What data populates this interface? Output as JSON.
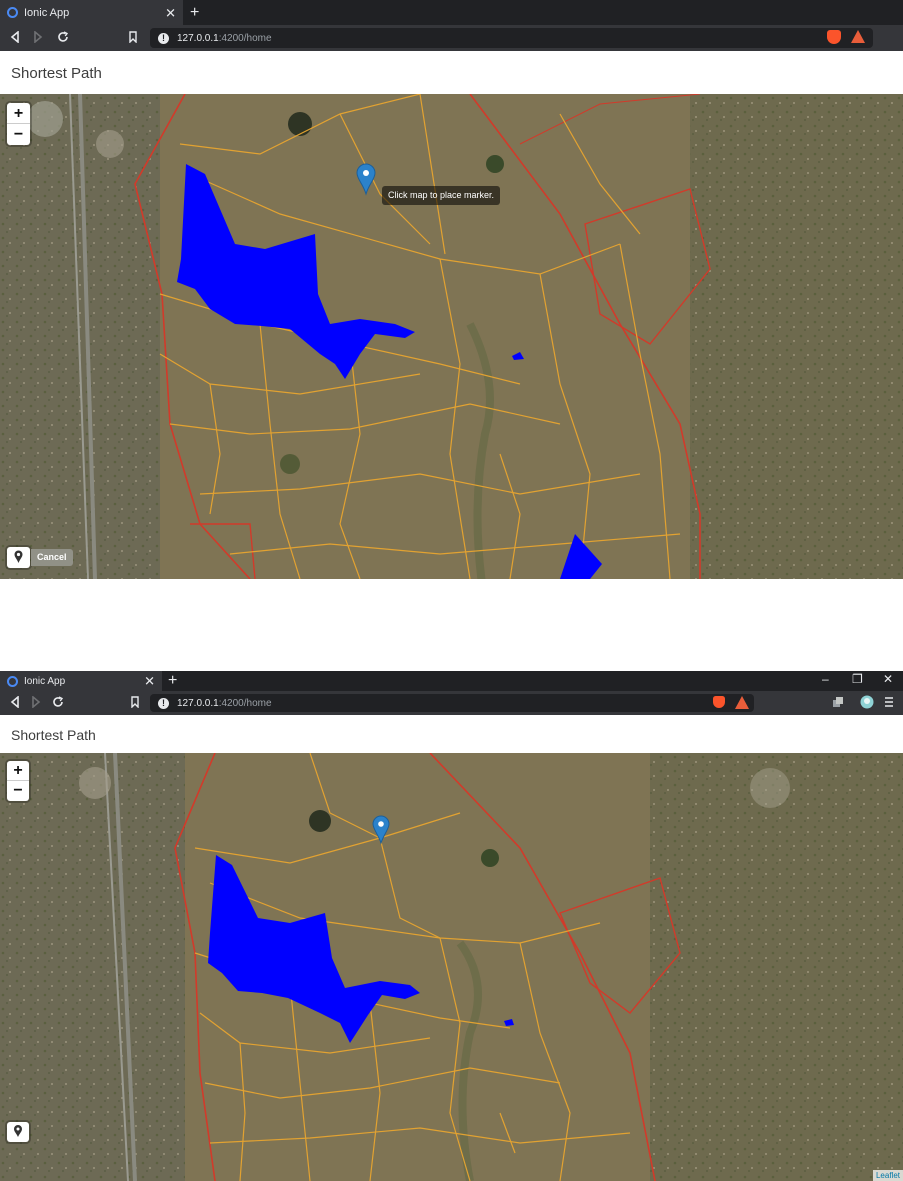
{
  "colors": {
    "browser_bg": "#202124",
    "tab_active": "#35363a",
    "water": "#0000ff",
    "path": "#e8a530",
    "boundary": "#d23a2a",
    "marker": "#2b82cb"
  },
  "icons": [
    "tab-favicon-icon",
    "back-icon",
    "forward-icon",
    "reload-icon",
    "bookmark-icon",
    "site-info-icon",
    "brave-shields-icon",
    "brave-rewards-icon",
    "extensions-icon",
    "profile-icon",
    "menu-icon",
    "map-marker-icon",
    "location-pin-icon"
  ],
  "frame1": {
    "tab": {
      "title": "Ionic App",
      "close": "✕"
    },
    "new_tab": "+",
    "url": {
      "host": "127.0.0.1",
      "rest": ":4200/home"
    },
    "page": {
      "title": "Shortest Path"
    },
    "map": {
      "zoom_in": "+",
      "zoom_out": "−",
      "tooltip": "Click map to place marker.",
      "cancel": "Cancel"
    }
  },
  "frame2": {
    "tab": {
      "title": "Ionic App",
      "close": "✕"
    },
    "new_tab": "+",
    "window": {
      "minimize": "–",
      "restore": "❐",
      "close": "✕"
    },
    "url": {
      "host": "127.0.0.1",
      "rest": ":4200/home"
    },
    "page": {
      "title": "Shortest Path"
    },
    "map": {
      "zoom_in": "+",
      "zoom_out": "−",
      "attribution": "Leaflet"
    }
  }
}
